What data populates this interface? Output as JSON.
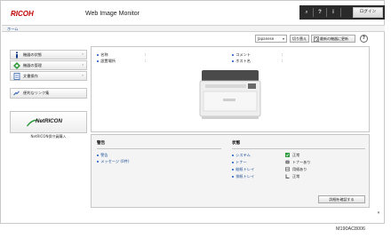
{
  "header": {
    "logo_text": "RICOH",
    "app_title": "Web Image Monitor",
    "login_label": "ログイン",
    "search_glyph": "⌕",
    "help_glyph": "?",
    "info_glyph": "i"
  },
  "breadcrumb": {
    "home": "ホーム"
  },
  "sidebar": {
    "items": [
      {
        "label": "機器の状態",
        "icon": "info-icon"
      },
      {
        "label": "機器の管理",
        "icon": "gear-diamond-icon"
      },
      {
        "label": "文書操作",
        "icon": "document-icon"
      }
    ],
    "favorite_links": "便利なリンク集",
    "netricon_logo": "NetRICON",
    "netricon_caption": "NetRICON保守員購入"
  },
  "toolbar": {
    "language_value": "Japanese",
    "switch_label": "切り替え",
    "refresh_label": "最新の機器に更新",
    "help_label": "?"
  },
  "device_info": {
    "left": [
      {
        "key": "名称",
        "value": ""
      },
      {
        "key": "設置場所",
        "value": ""
      }
    ],
    "right": [
      {
        "key": "コメント",
        "value": ""
      },
      {
        "key": "ホスト名",
        "value": ""
      }
    ]
  },
  "alerts": {
    "title": "警告",
    "items": [
      "警告",
      "メッセージ (0件)"
    ]
  },
  "status": {
    "title": "状態",
    "rows": [
      {
        "label": "システム",
        "value": "正常",
        "icon": "check-square-icon"
      },
      {
        "label": "トナー",
        "value": "トナーあり",
        "icon": "toner-icon"
      },
      {
        "label": "給紙トレイ",
        "value": "用紙あり",
        "icon": "tray-icon"
      },
      {
        "label": "排紙トレイ",
        "value": "正常",
        "icon": "output-tray-icon"
      }
    ],
    "detail_button": "詳細を確認する"
  },
  "figure_id": "M190AC8006",
  "colors": {
    "accent_blue": "#1a4d99",
    "highlight_green": "#1a9a3a",
    "topbar": "#2a2a2a"
  }
}
